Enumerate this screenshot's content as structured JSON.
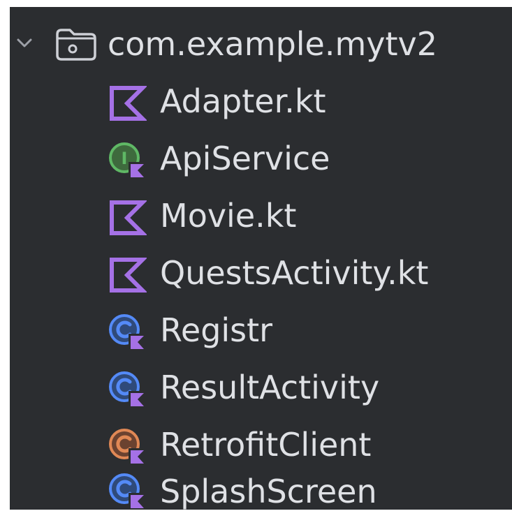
{
  "tree": {
    "package": {
      "label": "com.example.mytv2",
      "icon": "folder-icon",
      "expanded_icon": "chevron-down-icon"
    },
    "files": [
      {
        "name": "Adapter.kt",
        "icon": "kotlin-file-icon"
      },
      {
        "name": "ApiService",
        "icon": "kotlin-interface-icon"
      },
      {
        "name": "Movie.kt",
        "icon": "kotlin-file-icon"
      },
      {
        "name": "QuestsActivity.kt",
        "icon": "kotlin-file-icon"
      },
      {
        "name": "Registr",
        "icon": "kotlin-class-icon"
      },
      {
        "name": "ResultActivity",
        "icon": "kotlin-class-icon"
      },
      {
        "name": "RetrofitClient",
        "icon": "kotlin-object-icon"
      },
      {
        "name": "SplashScreen",
        "icon": "kotlin-class-icon"
      }
    ]
  },
  "colors": {
    "background": "#2b2d30",
    "text": "#dfe1e5",
    "kotlin_purple": "#a571e6",
    "interface_green": "#5fb865",
    "class_blue": "#548af7",
    "object_orange": "#e08855"
  }
}
